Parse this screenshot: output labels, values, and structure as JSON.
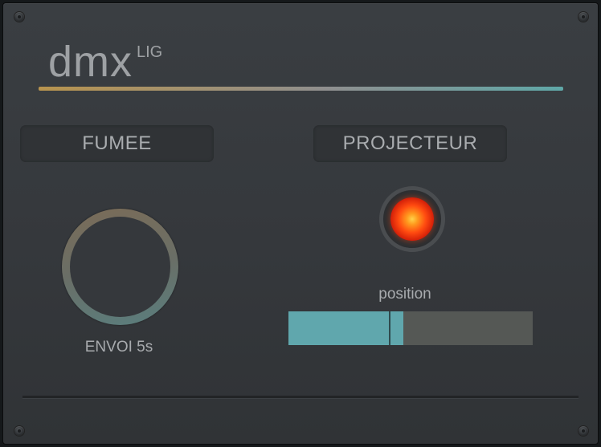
{
  "app": {
    "logo_text": "dmx",
    "logo_superscript": "LIG"
  },
  "colors": {
    "accent_gradient_start": "#b8944e",
    "accent_gradient_mid": "#8f8f8f",
    "accent_gradient_end": "#5fa8a8",
    "slider_fill": "#60a7ad",
    "slider_track": "#555855",
    "led_active": "#ff4a10"
  },
  "sections": {
    "smoke": {
      "title": "FUMEE",
      "knob_label": "ENVOI 5s"
    },
    "projector": {
      "title": "PROJECTEUR",
      "indicator_icon": "led-indicator-on",
      "slider_label": "position",
      "slider_value": 0.47
    }
  }
}
